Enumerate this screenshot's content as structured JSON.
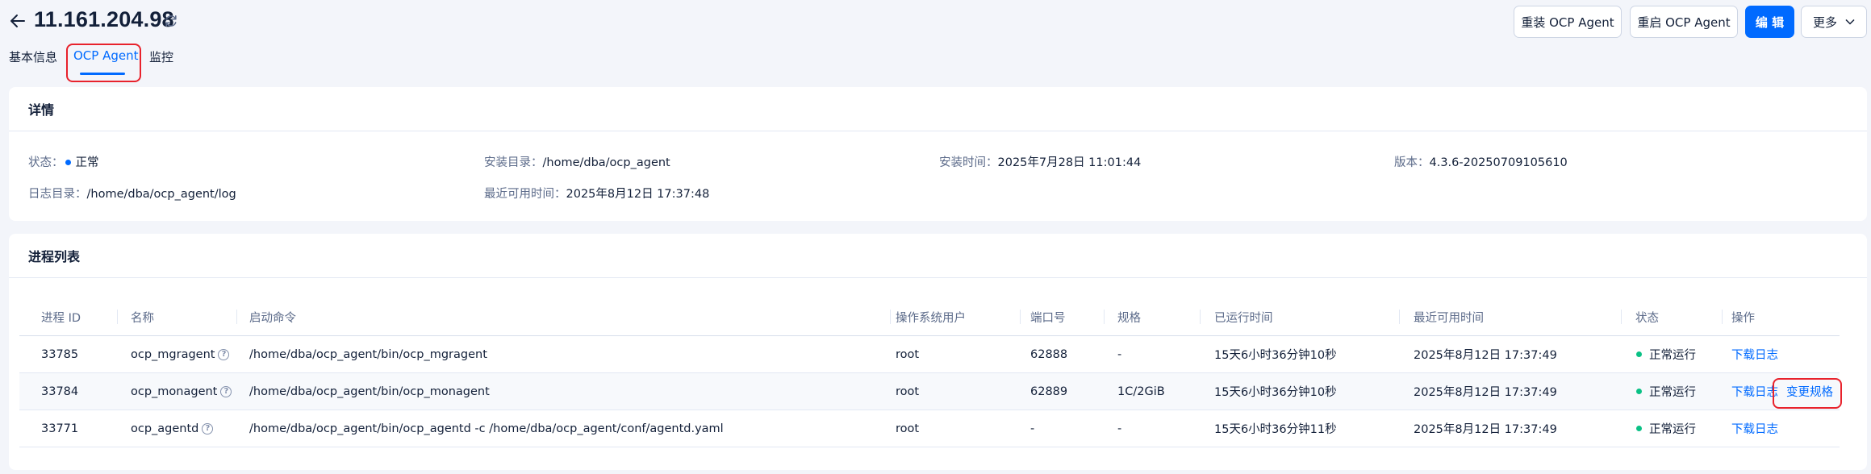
{
  "header": {
    "title": "11.161.204.98",
    "actions": {
      "reinstall": "重装 OCP Agent",
      "restart": "重启 OCP Agent",
      "edit": "编 辑",
      "more": "更多"
    }
  },
  "tabs": [
    {
      "label": "基本信息",
      "active": false
    },
    {
      "label": "OCP Agent",
      "active": true
    },
    {
      "label": "监控",
      "active": false
    }
  ],
  "details": {
    "title": "详情",
    "status_label": "状态：",
    "status_value": "正常",
    "install_dir_label": "安装目录：",
    "install_dir_value": "/home/dba/ocp_agent",
    "install_time_label": "安装时间：",
    "install_time_value": "2025年7月28日 11:01:44",
    "version_label": "版本：",
    "version_value": "4.3.6-20250709105610",
    "log_dir_label": "日志目录：",
    "log_dir_value": "/home/dba/ocp_agent/log",
    "last_available_label": "最近可用时间：",
    "last_available_value": "2025年8月12日 17:37:48"
  },
  "process_list": {
    "title": "进程列表",
    "columns": [
      "进程 ID",
      "名称",
      "启动命令",
      "操作系统用户",
      "端口号",
      "规格",
      "已运行时间",
      "最近可用时间",
      "状态",
      "操作"
    ],
    "rows": [
      {
        "pid": "33785",
        "name": "ocp_mgragent",
        "cmd": "/home/dba/ocp_agent/bin/ocp_mgragent",
        "user": "root",
        "port": "62888",
        "spec": "-",
        "uptime": "15天6小时36分钟10秒",
        "last": "2025年8月12日 17:37:49",
        "status": "正常运行",
        "op1": "下载日志",
        "op2": ""
      },
      {
        "pid": "33784",
        "name": "ocp_monagent",
        "cmd": "/home/dba/ocp_agent/bin/ocp_monagent",
        "user": "root",
        "port": "62889",
        "spec": "1C/2GiB",
        "uptime": "15天6小时36分钟10秒",
        "last": "2025年8月12日 17:37:49",
        "status": "正常运行",
        "op1": "下载日志",
        "op2": "变更规格"
      },
      {
        "pid": "33771",
        "name": "ocp_agentd",
        "cmd": "/home/dba/ocp_agent/bin/ocp_agentd -c /home/dba/ocp_agent/conf/agentd.yaml",
        "user": "root",
        "port": "-",
        "spec": "-",
        "uptime": "15天6小时36分钟11秒",
        "last": "2025年8月12日 17:37:49",
        "status": "正常运行",
        "op1": "下载日志",
        "op2": ""
      }
    ]
  },
  "colors": {
    "primary": "#006aff",
    "success": "#0ac185",
    "highlight": "#e8222c"
  }
}
